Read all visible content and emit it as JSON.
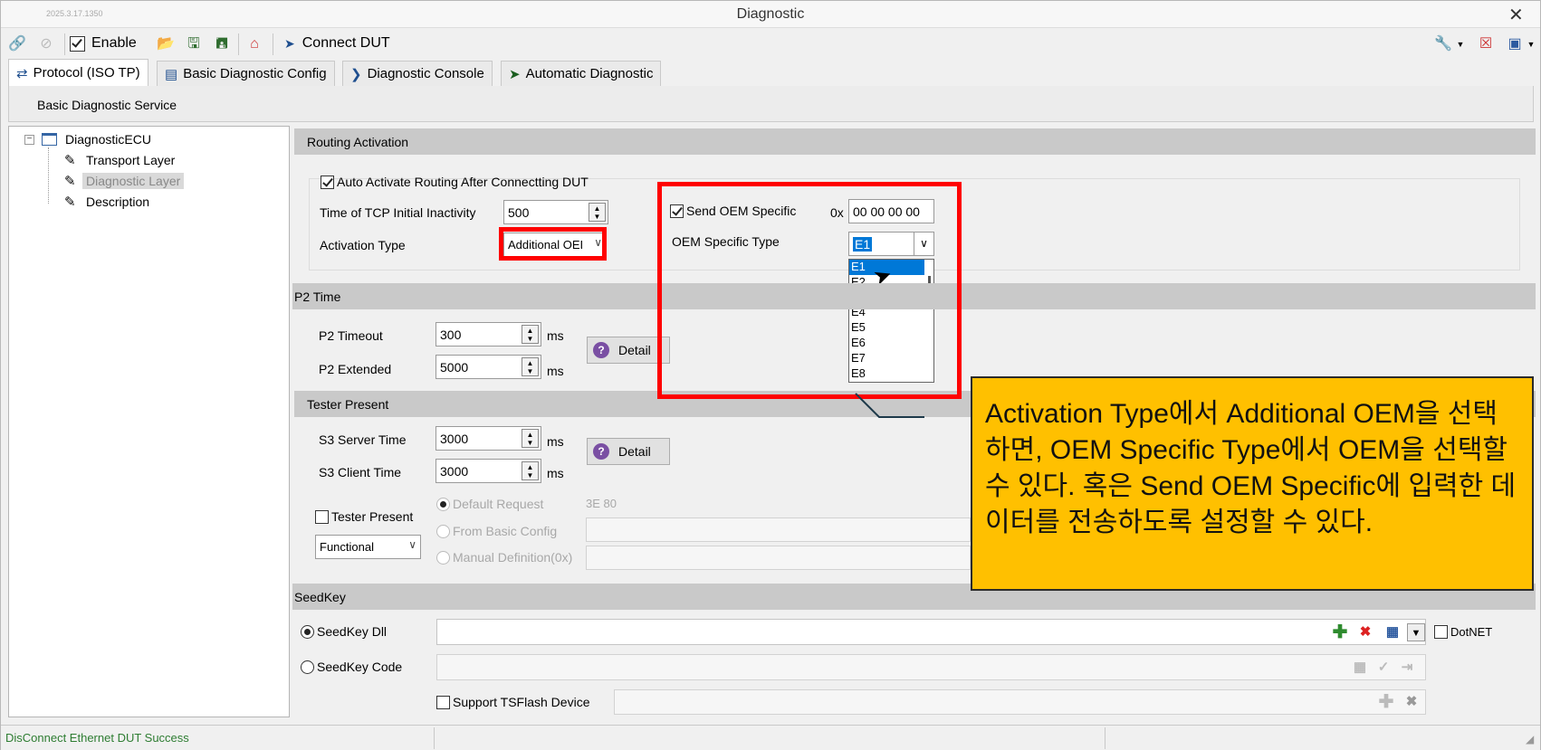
{
  "window": {
    "version": "2025.3.17.1350",
    "title": "Diagnostic",
    "close": "✕"
  },
  "toolbar": {
    "enable_label": "Enable",
    "connect_label": "Connect DUT"
  },
  "tabs": [
    {
      "label": "Protocol (ISO TP)"
    },
    {
      "label": "Basic Diagnostic Config"
    },
    {
      "label": "Diagnostic Console"
    },
    {
      "label": "Automatic Diagnostic"
    }
  ],
  "service_bar": {
    "label": "Basic Diagnostic Service"
  },
  "tree": {
    "root": "DiagnosticECU",
    "items": [
      {
        "label": "Transport Layer"
      },
      {
        "label": "Diagnostic Layer"
      },
      {
        "label": "Description"
      }
    ]
  },
  "routing": {
    "header": "Routing Activation",
    "auto_activate_label": "Auto Activate Routing After Connectting DUT",
    "tcp_label": "Time of TCP Initial Inactivity",
    "tcp_value": "500",
    "activation_type_label": "Activation Type",
    "activation_type_value": "Additional OEI",
    "send_oem_label": "Send OEM Specific",
    "hex_prefix": "0x",
    "oem_value": "00 00 00 00",
    "oem_type_label": "OEM Specific Type",
    "oem_type_value": "E1",
    "oem_options": [
      "E1",
      "E2",
      "E3",
      "E4",
      "E5",
      "E6",
      "E7",
      "E8"
    ]
  },
  "p2": {
    "header": "P2 Time",
    "timeout_label": "P2 Timeout",
    "timeout_value": "300",
    "extended_label": "P2 Extended",
    "extended_value": "5000",
    "unit": "ms",
    "detail_label": "Detail"
  },
  "tester": {
    "header": "Tester Present",
    "s3_server_label": "S3 Server Time",
    "s3_server_value": "3000",
    "s3_client_label": "S3 Client Time",
    "s3_client_value": "3000",
    "unit": "ms",
    "detail_label": "Detail",
    "tester_present_label": "Tester Present",
    "mode_value": "Functional",
    "default_request_label": "Default Request",
    "default_request_value": "3E 80",
    "from_basic_label": "From Basic Config",
    "manual_label": "Manual Definition(0x)"
  },
  "seedkey": {
    "header": "SeedKey",
    "dll_label": "SeedKey Dll",
    "code_label": "SeedKey Code",
    "dotnet_label": "DotNET",
    "tsflash_label": "Support TSFlash Device"
  },
  "status": {
    "message": "DisConnect Ethernet DUT Success"
  },
  "callout": {
    "text": "Activation Type에서 Additional OEM을 선택하면, OEM Specific Type에서 OEM을 선택할 수 있다. 혹은 Send OEM Specific에 입력한 데이터를 전송하도록 설정할 수 있다."
  },
  "colors": {
    "callout_bg": "#ffc000",
    "highlight": "#ff0000",
    "selection": "#0078d7"
  }
}
